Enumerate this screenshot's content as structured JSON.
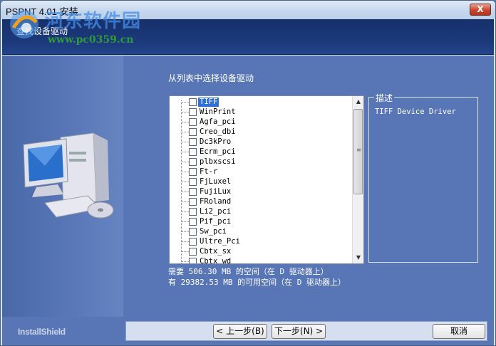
{
  "window": {
    "title": "PSPNT 4.01 安装",
    "close_label": "X"
  },
  "header": {
    "title": "查找设备驱动"
  },
  "watermark": {
    "site_name": "河东软件园",
    "url": "www.pc0359.cn"
  },
  "main": {
    "instruction": "从列表中选择设备驱动",
    "drivers": [
      {
        "label": "TIFF",
        "selected": true
      },
      {
        "label": "WinPrint"
      },
      {
        "label": "Agfa_pci"
      },
      {
        "label": "Creo_dbi"
      },
      {
        "label": "Dc3kPro"
      },
      {
        "label": "Ecrm_pci"
      },
      {
        "label": "plbxscsi"
      },
      {
        "label": "Ft-r"
      },
      {
        "label": "FjLuxel"
      },
      {
        "label": "FujiLux"
      },
      {
        "label": "FRoland"
      },
      {
        "label": "Li2_pci"
      },
      {
        "label": "Pif_pci"
      },
      {
        "label": "Sw_pci"
      },
      {
        "label": "Ultre_Pci"
      },
      {
        "label": "Cbtx_sx"
      },
      {
        "label": "Cbtx_wd"
      }
    ],
    "description_legend": "描述",
    "description_text": "TIFF Device Driver",
    "space_required": "需要 506.30 MB 的空间（在 D 驱动器上）",
    "space_available": "有 29382.53 MB 的可用空间（在 D 驱动器上）"
  },
  "footer": {
    "brand": "InstallShield",
    "back_label": "< 上一步(B)",
    "next_label": "下一步(N) >",
    "cancel_label": "取消"
  },
  "colors": {
    "background": "#5876b5",
    "header_band": "#1c3a7c",
    "selection": "#3070d8"
  }
}
